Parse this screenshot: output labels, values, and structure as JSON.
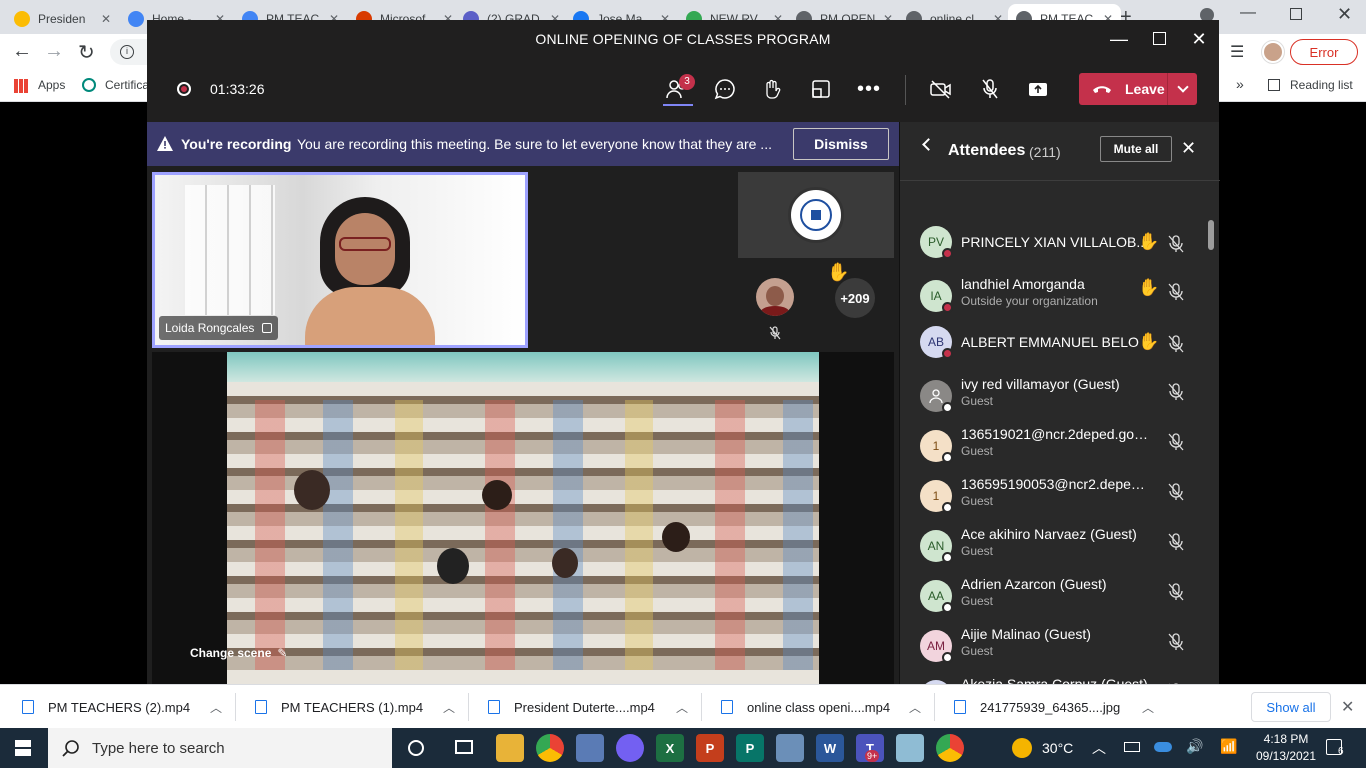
{
  "browser": {
    "tabs": [
      {
        "label": "Presiden",
        "color": "#fbbc04"
      },
      {
        "label": "Home - ",
        "color": "#4285f4"
      },
      {
        "label": "PM TEAC",
        "color": "#4285f4"
      },
      {
        "label": "Microsof",
        "color": "#d83b01"
      },
      {
        "label": "(2) GRAD",
        "color": "#5b5fc7"
      },
      {
        "label": "Jose Ma",
        "color": "#1877f2"
      },
      {
        "label": "NEW RV",
        "color": "#34a853"
      },
      {
        "label": "PM OPEN",
        "color": "#5f6368"
      },
      {
        "label": "online cl",
        "color": "#5f6368"
      },
      {
        "label": "PM TEAC",
        "color": "#5f6368"
      }
    ],
    "bookmarks": {
      "apps": "Apps",
      "cert": "Certifica",
      "reading_list": "Reading list"
    },
    "profile_error": "Error"
  },
  "teams": {
    "window_title": "ONLINE OPENING OF CLASSES PROGRAM",
    "timer": "01:33:26",
    "participants_badge": "3",
    "leave_label": "Leave",
    "banner": {
      "title": "You're recording",
      "message": "You are recording this meeting. Be sure to let everyone know that they are ...",
      "dismiss": "Dismiss"
    },
    "presenter_name": "Loida Rongcales",
    "overflow_count": "+209",
    "change_scene": "Change scene",
    "panel": {
      "title": "Attendees",
      "count": "(211)",
      "mute_all": "Mute all"
    },
    "attendees": [
      {
        "initials": "PV",
        "name": "PRINCELY XIAN VILLALOB...",
        "sub": "",
        "hand": true,
        "color": "#cfe5cf",
        "tcolor": "#2a5c2a",
        "presence": "#c4314b"
      },
      {
        "initials": "IA",
        "name": "landhiel Amorganda",
        "sub": "Outside your organization",
        "hand": true,
        "color": "#cfe5cf",
        "tcolor": "#2a5c2a",
        "presence": "#c4314b"
      },
      {
        "initials": "AB",
        "name": "ALBERT EMMANUEL BELO",
        "sub": "",
        "hand": true,
        "color": "#d5d9f0",
        "tcolor": "#2d3573",
        "presence": "#c4314b"
      },
      {
        "initials": "",
        "name": "ivy red villamayor (Guest)",
        "sub": "Guest",
        "hand": false,
        "color": "#8a8886",
        "tcolor": "#fff",
        "presence": "#fff"
      },
      {
        "initials": "1",
        "name": "136519021@ncr.2deped.gov....",
        "sub": "Guest",
        "hand": false,
        "color": "#f4e0c7",
        "tcolor": "#7a4a12",
        "presence": "#fff"
      },
      {
        "initials": "1",
        "name": "136595190053@ncr2.deped.g...",
        "sub": "Guest",
        "hand": false,
        "color": "#f4e0c7",
        "tcolor": "#7a4a12",
        "presence": "#fff"
      },
      {
        "initials": "AN",
        "name": "Ace akihiro Narvaez (Guest)",
        "sub": "Guest",
        "hand": false,
        "color": "#cfe5cf",
        "tcolor": "#2a5c2a",
        "presence": "#fff"
      },
      {
        "initials": "AA",
        "name": "Adrien Azarcon (Guest)",
        "sub": "Guest",
        "hand": false,
        "color": "#cfe5cf",
        "tcolor": "#2a5c2a",
        "presence": "#fff"
      },
      {
        "initials": "AM",
        "name": "Aijie Malinao (Guest)",
        "sub": "Guest",
        "hand": false,
        "color": "#f2d4dd",
        "tcolor": "#7a2040",
        "presence": "#fff"
      },
      {
        "initials": "AC",
        "name": "Akezia Samra Corpuz (Guest)",
        "sub": "Guest",
        "hand": false,
        "color": "#d5d9f0",
        "tcolor": "#2d3573",
        "presence": "#fff"
      }
    ]
  },
  "downloads": {
    "items": [
      "PM TEACHERS (2).mp4",
      "PM TEACHERS (1).mp4",
      "President Duterte....mp4",
      "online class openi....mp4",
      "241775939_64365....jpg"
    ],
    "show_all": "Show all"
  },
  "taskbar": {
    "search_placeholder": "Type here to search",
    "weather": "30°C",
    "time": "4:18 PM",
    "date": "09/13/2021",
    "notifications": "6",
    "teams_badge": "9+"
  }
}
